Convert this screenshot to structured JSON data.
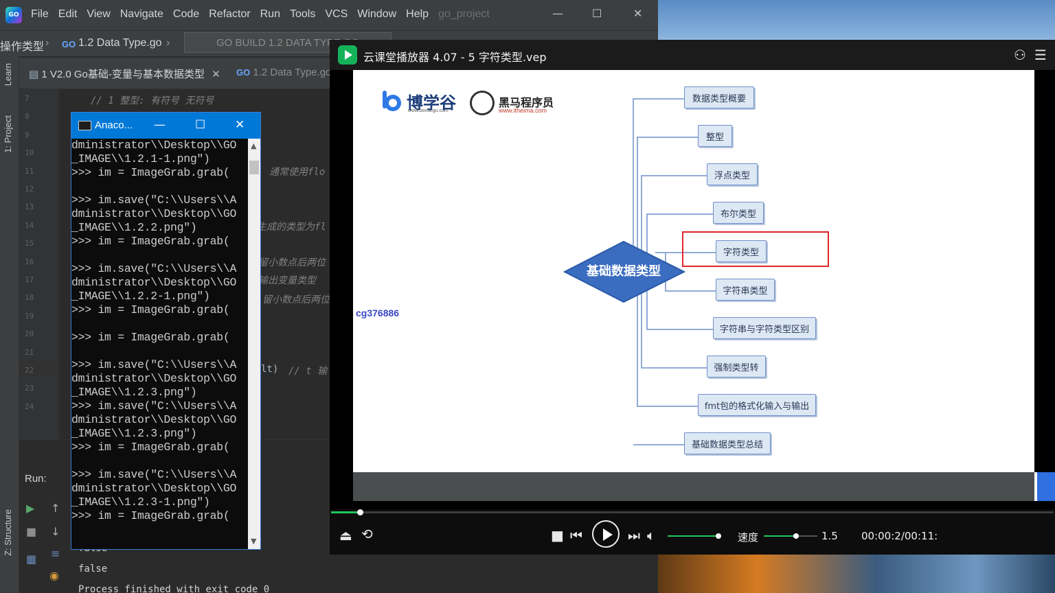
{
  "ide": {
    "menu": [
      "File",
      "Edit",
      "View",
      "Navigate",
      "Code",
      "Refactor",
      "Run",
      "Tools",
      "VCS",
      "Window",
      "Help"
    ],
    "project_name": "go_project",
    "breadcrumb_folder": "操作类型",
    "breadcrumb_file": "1.2 Data Type.go",
    "run_config": "GO BUILD 1.2 DATA TYPE.GO",
    "tabs": [
      "1 V2.0 Go基础-变量与基本数据类型",
      "1.2 Data Type.go"
    ],
    "side_labels": {
      "learn": "Learn",
      "project": "1: Project",
      "structure": "Z: Structure"
    },
    "line_numbers": [
      "7",
      "8",
      "9",
      "10",
      "11",
      "12",
      "13",
      "14",
      "15",
      "16",
      "17",
      "18",
      "19",
      "20",
      "21",
      "22",
      "23",
      "24"
    ],
    "code_comments": {
      "line7": "// 1 整型:  有符号 无符号",
      "line11": "通常使用flo",
      "line14": "生成的类型为fl",
      "line16": "留小数点后两位",
      "line17": "输出变量类型",
      "line18": "留小数点后两位",
      "line22_code": "lt)",
      "line22_comment": "// t 输"
    },
    "run_label": "Run:",
    "output": [
      "false",
      "false",
      "Process finished with exit code 0"
    ]
  },
  "console": {
    "title": "Anaco...",
    "lines": [
      "dministrator\\\\Desktop\\\\GO",
      "_IMAGE\\\\1.2.1-1.png\")",
      ">>> im = ImageGrab.grab(",
      "",
      ">>> im.save(\"C:\\\\Users\\\\A",
      "dministrator\\\\Desktop\\\\GO",
      "_IMAGE\\\\1.2.2.png\")",
      ">>> im = ImageGrab.grab(",
      "",
      ">>> im.save(\"C:\\\\Users\\\\A",
      "dministrator\\\\Desktop\\\\GO",
      "_IMAGE\\\\1.2.2-1.png\")",
      ">>> im = ImageGrab.grab(",
      "",
      ">>> im = ImageGrab.grab(",
      "",
      ">>> im.save(\"C:\\\\Users\\\\A",
      "dministrator\\\\Desktop\\\\GO",
      "_IMAGE\\\\1.2.3.png\")",
      ">>> im.save(\"C:\\\\Users\\\\A",
      "dministrator\\\\Desktop\\\\GO",
      "_IMAGE\\\\1.2.3.png\")",
      ">>> im = ImageGrab.grab(",
      "",
      ">>> im.save(\"C:\\\\Users\\\\A",
      "dministrator\\\\Desktop\\\\GO",
      "_IMAGE\\\\1.2.3-1.png\")",
      ">>> im = ImageGrab.grab("
    ]
  },
  "player": {
    "title": "云课堂播放器 4.07 - 5 字符类型.vep",
    "speed_label": "速度",
    "speed_value": "1.5",
    "time": "00:00:2/00:11:",
    "progress_fraction": 0.04,
    "volume_fraction": 1.0,
    "speed_slider_fraction": 0.6
  },
  "slide": {
    "brand1": "博学谷",
    "brand1_url": "www.boxuegu.com",
    "brand2": "黑马程序员",
    "brand2_url": "www.itheima.com",
    "watermark": "cg376886",
    "root": "基础数据类型",
    "nodes": [
      "数据类型概要",
      "整型",
      "浮点类型",
      "布尔类型",
      "字符类型",
      "字符串类型",
      "字符串与字符类型区别",
      "强制类型转",
      "fmt包的格式化输入与输出",
      "基础数据类型总结"
    ],
    "highlighted": "字符类型",
    "colors": {
      "node_fill": "#dde8f5",
      "node_border": "#6f8fc8",
      "root_fill": "#3a6cc0",
      "highlight": "#e0252b"
    }
  }
}
